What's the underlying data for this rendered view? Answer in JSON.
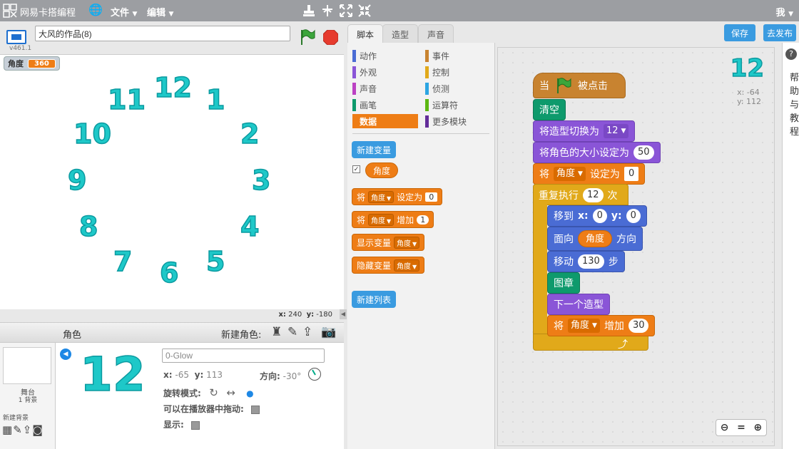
{
  "menubar": {
    "brand": "网易卡搭编程",
    "menu_file": "文件",
    "menu_edit": "编辑",
    "user": "我"
  },
  "stage": {
    "project_title": "大风的作品(8)",
    "version": "v461.1",
    "variable_monitor": {
      "name": "角度",
      "value": "360"
    },
    "clock_numbers": [
      "12",
      "1",
      "2",
      "3",
      "4",
      "5",
      "6",
      "7",
      "8",
      "9",
      "10",
      "11"
    ],
    "coords_x_label": "x:",
    "coords_x": "240",
    "coords_y_label": "y:",
    "coords_y": "-180"
  },
  "sprites": {
    "header_label": "角色",
    "new_sprite_label": "新建角色:",
    "stage_label": "舞台",
    "stage_backdrops": "1 背景",
    "new_backdrop_label": "新建背景",
    "sprite_costume_preview": "12",
    "sprite_name": "0-Glow",
    "x_label": "x:",
    "x": "-65",
    "y_label": "y:",
    "y": "113",
    "direction_label": "方向:",
    "direction": "-30°",
    "rotation_mode_label": "旋转模式:",
    "draggable_label": "可以在播放器中拖动:",
    "show_label": "显示:"
  },
  "tabs": [
    "脚本",
    "造型",
    "声音"
  ],
  "categories": {
    "left": [
      {
        "label": "动作",
        "color": "#4a6cd4"
      },
      {
        "label": "外观",
        "color": "#8a55d7"
      },
      {
        "label": "声音",
        "color": "#bb42c3"
      },
      {
        "label": "画笔",
        "color": "#0e9a6c"
      },
      {
        "label": "数据",
        "color": "#ee7d16"
      }
    ],
    "right": [
      {
        "label": "事件",
        "color": "#c88330"
      },
      {
        "label": "控制",
        "color": "#e1a91a"
      },
      {
        "label": "侦测",
        "color": "#2ca5e2"
      },
      {
        "label": "运算符",
        "color": "#5cb712"
      },
      {
        "label": "更多模块",
        "color": "#632d99"
      }
    ]
  },
  "palette": {
    "new_variable": "新建变量",
    "variable_reporter": "角度",
    "set_block": {
      "prefix": "将",
      "var": "角度",
      "mid": "设定为",
      "value": "0"
    },
    "change_block": {
      "prefix": "将",
      "var": "角度",
      "mid": "增加",
      "value": "1"
    },
    "show_var_block": {
      "label": "显示变量",
      "var": "角度"
    },
    "hide_var_block": {
      "label": "隐藏变量",
      "var": "角度"
    },
    "new_list": "新建列表"
  },
  "actions": {
    "save": "保存",
    "publish": "去发布"
  },
  "help": {
    "text": "帮助与教程"
  },
  "script": {
    "mini_costume": "12",
    "mini_x": "x: -64",
    "mini_y": "y: 112",
    "when_flag": {
      "prefix": "当",
      "suffix": "被点击"
    },
    "clear": "清空",
    "switch_costume": {
      "label": "将造型切换为",
      "value": "12"
    },
    "set_size": {
      "label": "将角色的大小设定为",
      "value": "50"
    },
    "set_var": {
      "prefix": "将",
      "var": "角度",
      "mid": "设定为",
      "value": "0"
    },
    "repeat": {
      "label": "重复执行",
      "value": "12",
      "suffix": "次"
    },
    "goto": {
      "label": "移到",
      "x_label": "x:",
      "x": "0",
      "y_label": "y:",
      "y": "0"
    },
    "point": {
      "label": "面向",
      "value": "角度",
      "suffix": "方向"
    },
    "move": {
      "label": "移动",
      "value": "130",
      "suffix": "步"
    },
    "stamp": "图章",
    "next_costume": "下一个造型",
    "change_var": {
      "prefix": "将",
      "var": "角度",
      "mid": "增加",
      "value": "30"
    }
  }
}
